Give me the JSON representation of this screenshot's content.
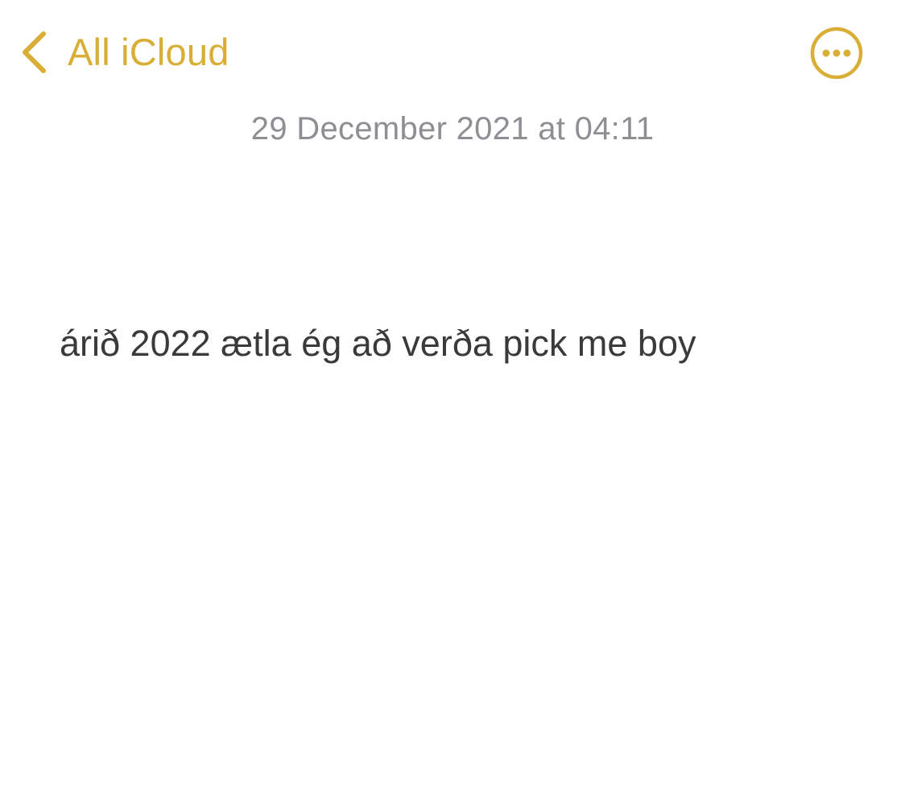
{
  "nav": {
    "back_label": "All iCloud",
    "back_icon": "chevron-left-icon",
    "more_icon": "ellipsis-circle-icon",
    "accent_color": "#D9AE36"
  },
  "note": {
    "date": "29 December 2021 at 04:11",
    "body": "árið 2022 ætla ég að verða pick me boy"
  }
}
